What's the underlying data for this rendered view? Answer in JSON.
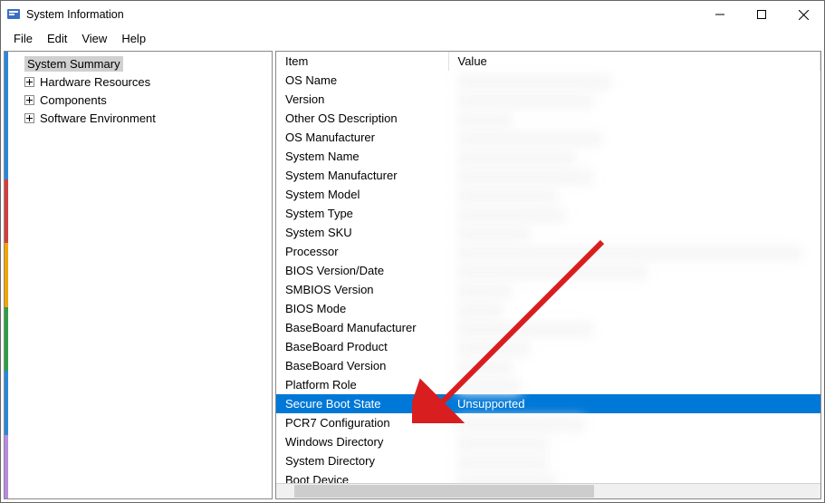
{
  "window": {
    "title": "System Information"
  },
  "menu": [
    "File",
    "Edit",
    "View",
    "Help"
  ],
  "tree": {
    "root": "System Summary",
    "children": [
      {
        "label": "Hardware Resources",
        "expandable": true
      },
      {
        "label": "Components",
        "expandable": true
      },
      {
        "label": "Software Environment",
        "expandable": true
      }
    ]
  },
  "columns": {
    "item": "Item",
    "value": "Value"
  },
  "rows": [
    {
      "item": "OS Name",
      "value": "",
      "blurred": true
    },
    {
      "item": "Version",
      "value": "",
      "blurred": true
    },
    {
      "item": "Other OS Description",
      "value": "",
      "blurred": true
    },
    {
      "item": "OS Manufacturer",
      "value": "",
      "blurred": true
    },
    {
      "item": "System Name",
      "value": "",
      "blurred": true
    },
    {
      "item": "System Manufacturer",
      "value": "",
      "blurred": true
    },
    {
      "item": "System Model",
      "value": "",
      "blurred": true
    },
    {
      "item": "System Type",
      "value": "",
      "blurred": true
    },
    {
      "item": "System SKU",
      "value": "",
      "blurred": true
    },
    {
      "item": "Processor",
      "value": "",
      "blurred": true
    },
    {
      "item": "BIOS Version/Date",
      "value": "",
      "blurred": true
    },
    {
      "item": "SMBIOS Version",
      "value": "",
      "blurred": true
    },
    {
      "item": "BIOS Mode",
      "value": "",
      "blurred": true
    },
    {
      "item": "BaseBoard Manufacturer",
      "value": "",
      "blurred": true
    },
    {
      "item": "BaseBoard Product",
      "value": "",
      "blurred": true
    },
    {
      "item": "BaseBoard Version",
      "value": "",
      "blurred": true
    },
    {
      "item": "Platform Role",
      "value": "",
      "blurred": true
    },
    {
      "item": "Secure Boot State",
      "value": "Unsupported",
      "selected": true
    },
    {
      "item": "PCR7 Configuration",
      "value": "",
      "blurred": true
    },
    {
      "item": "Windows Directory",
      "value": "",
      "blurred": true
    },
    {
      "item": "System Directory",
      "value": "",
      "blurred": true
    },
    {
      "item": "Boot Device",
      "value": "",
      "blurred": true
    }
  ],
  "edge_colors": [
    "#2a88d8",
    "#2a88d8",
    "#d23f3f",
    "#f0a500",
    "#2f9e44",
    "#2a88d8",
    "#b78be0"
  ]
}
